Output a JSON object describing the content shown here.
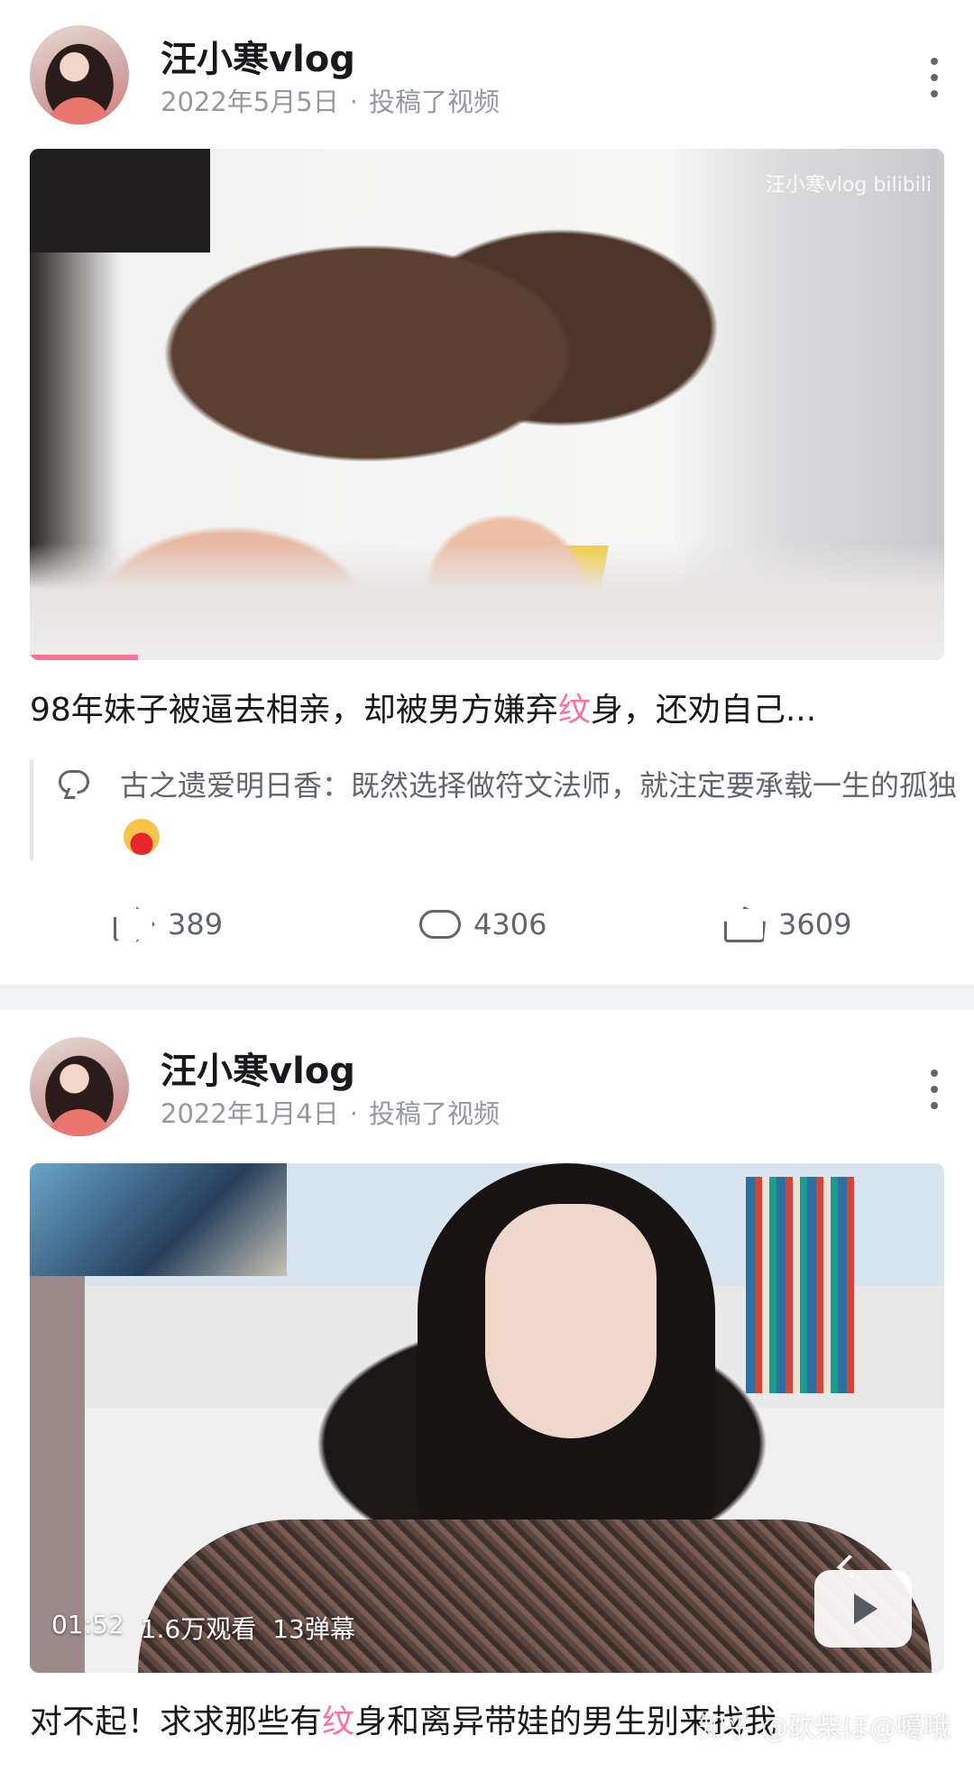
{
  "posts": [
    {
      "author": "汪小寒vlog",
      "date": "2022年5月5日",
      "separator": "·",
      "action": "投稿了视频",
      "watermark": "汪小寒vlog bilibili",
      "title_parts": [
        "98年妹子被逼去相亲，却被男方嫌弃",
        "纹",
        "身，还劝自己..."
      ],
      "comment": {
        "user": "古之遗爱明日香",
        "text": "：既然选择做符文法师，就注定要承载一生的孤独"
      },
      "stats": {
        "shares": "389",
        "comments": "4306",
        "likes": "3609"
      }
    },
    {
      "author": "汪小寒vlog",
      "date": "2022年1月4日",
      "separator": "·",
      "action": "投稿了视频",
      "duration": "01:52",
      "views": "1.6万观看",
      "danmaku": "13弹幕",
      "title_parts": [
        "对不起！求求那些有",
        "纹",
        "身和离异带娃的男生别来找我"
      ]
    }
  ],
  "overlay_watermark": "知乎 @砍柴ほ@噶哦",
  "accent_color": "#fb7299",
  "icons": [
    "more-icon",
    "comment-icon",
    "share-icon",
    "reply-icon",
    "like-icon",
    "play-icon",
    "emoji-icon"
  ]
}
